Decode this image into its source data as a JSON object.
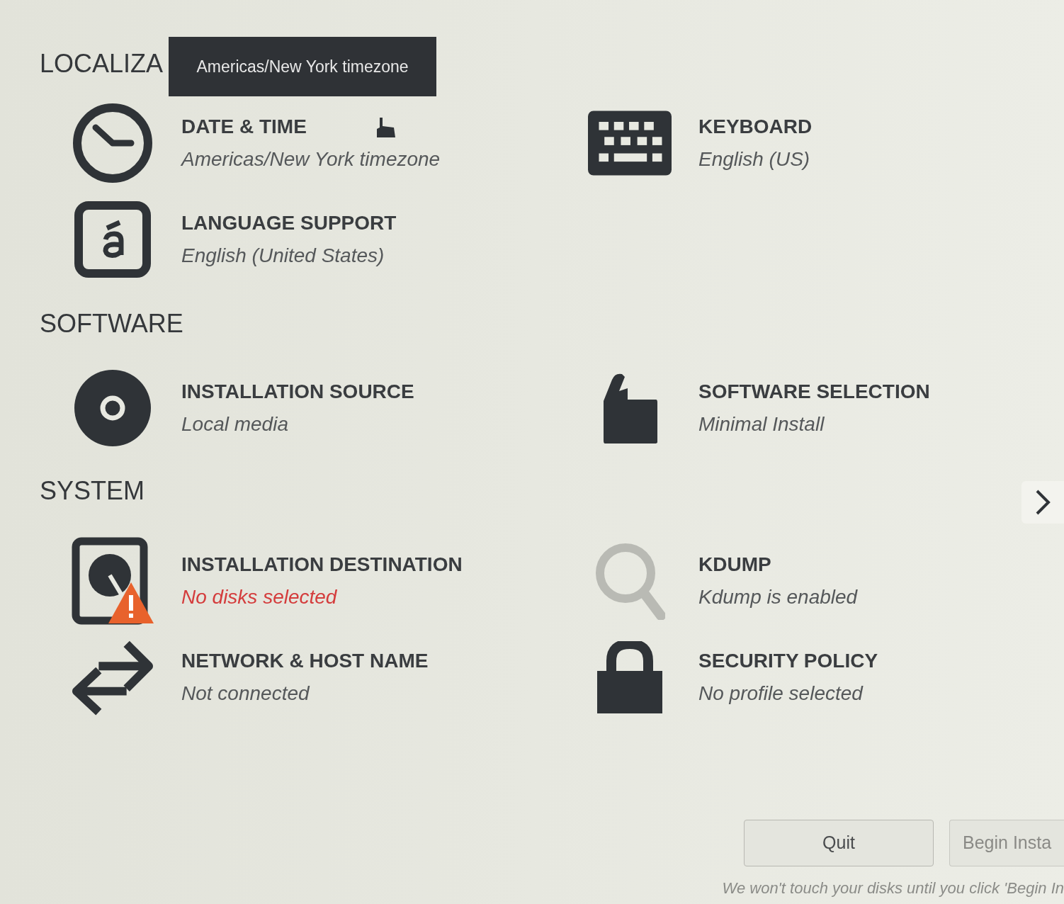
{
  "sections": [
    {
      "heading": "LOCALIZA",
      "items": [
        {
          "kind": "clock",
          "title": "DATE & TIME",
          "status": "Americas/New York timezone",
          "warning": false
        },
        {
          "kind": "keyboard",
          "title": "KEYBOARD",
          "status": "English (US)",
          "warning": false
        },
        {
          "kind": "language",
          "title": "LANGUAGE SUPPORT",
          "status": "English (United States)",
          "warning": false
        }
      ]
    },
    {
      "heading": "SOFTWARE",
      "items": [
        {
          "kind": "disc",
          "title": "INSTALLATION SOURCE",
          "status": "Local media",
          "warning": false
        },
        {
          "kind": "package",
          "title": "SOFTWARE SELECTION",
          "status": "Minimal Install",
          "warning": false
        }
      ]
    },
    {
      "heading": "SYSTEM",
      "items": [
        {
          "kind": "disk",
          "title": "INSTALLATION DESTINATION",
          "status": "No disks selected",
          "warning": true
        },
        {
          "kind": "magnifier",
          "title": "KDUMP",
          "status": "Kdump is enabled",
          "warning": false
        },
        {
          "kind": "arrows",
          "title": "NETWORK & HOST NAME",
          "status": "Not connected",
          "warning": false
        },
        {
          "kind": "lock",
          "title": "SECURITY POLICY",
          "status": "No profile selected",
          "warning": false
        }
      ]
    }
  ],
  "tooltip": {
    "text": "Americas/New York timezone"
  },
  "buttons": [
    {
      "label": "Quit"
    },
    {
      "label": "Begin Insta"
    }
  ],
  "footer": "We won't touch your disks until you click 'Begin In"
}
